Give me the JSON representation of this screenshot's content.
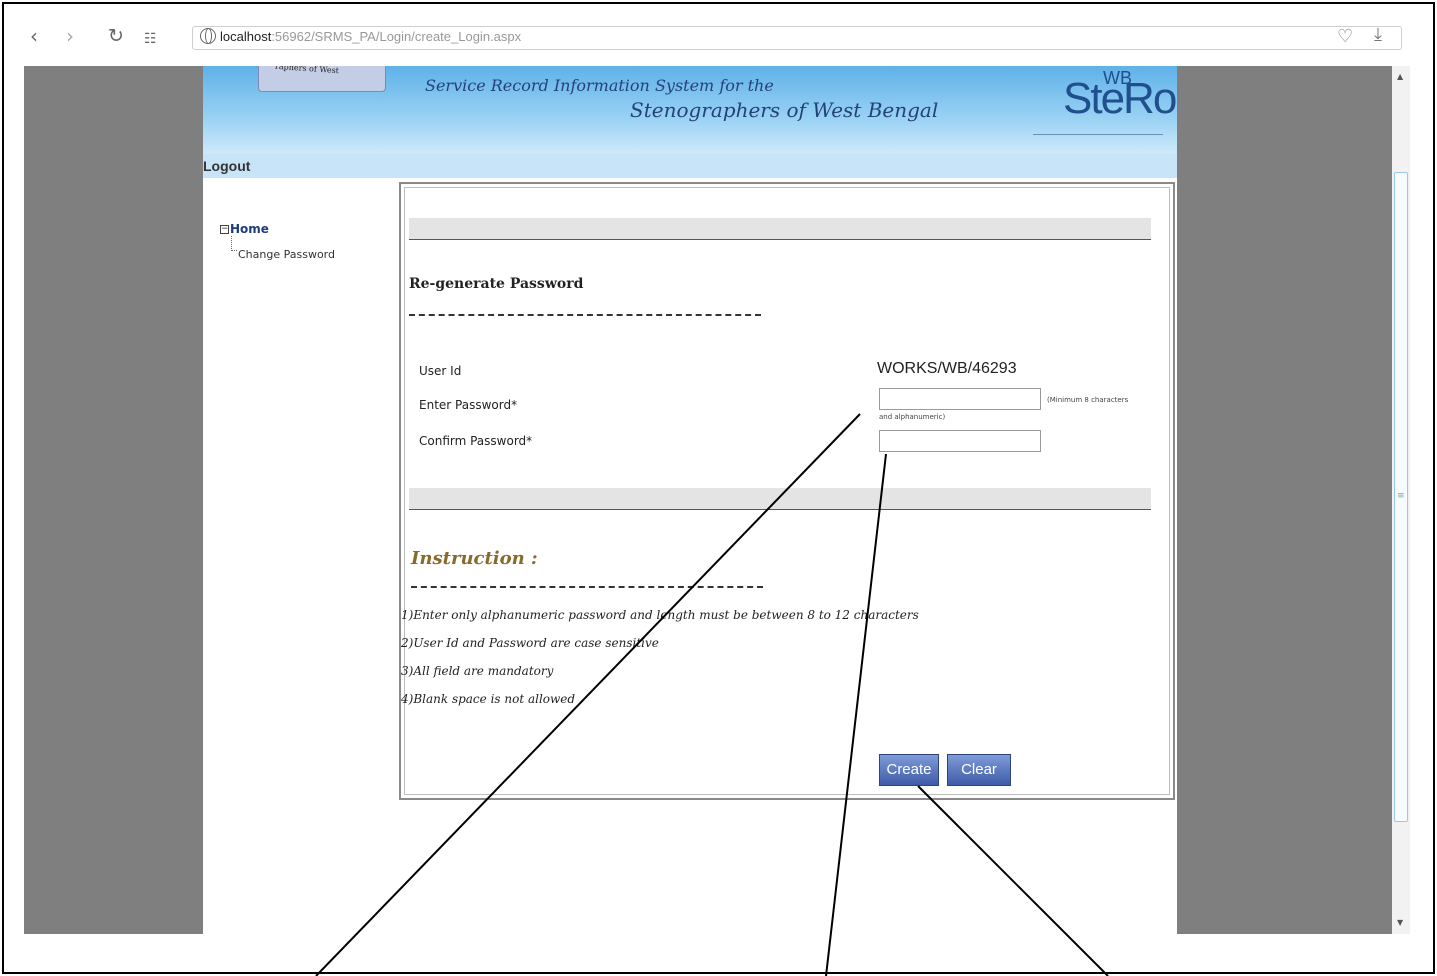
{
  "browser": {
    "back_icon": "chevron-left-icon",
    "forward_icon": "chevron-right-icon",
    "url_host": "localhost",
    "url_rest": ":56962/SRMS_PA/Login/create_Login.aspx"
  },
  "banner": {
    "logo_text": "raphers of West",
    "line1": "Service Record Information System for the",
    "line2": "Stenographers of West Bengal",
    "brand": "SteRo",
    "brand_small": "WB"
  },
  "nav": {
    "logout": "Logout",
    "tree_home": "Home",
    "tree_item": "Change Password"
  },
  "form": {
    "title": "Re-generate Password",
    "user_id_label": "User Id",
    "user_id_value": "WORKS/WB/46293",
    "enter_password_label": "Enter Password*",
    "password_hint_1": "(Minimum 8 characters",
    "password_hint_2": "and alphanumeric)",
    "confirm_password_label": "Confirm Password*",
    "create_button": "Create",
    "clear_button": "Clear"
  },
  "instructions": {
    "title": "Instruction :",
    "items": [
      "1)Enter only alphanumeric password and length must be between 8 to 12 characters",
      "2)User Id and Password are case sensitive",
      "3)All field are mandatory",
      "4)Blank space is not allowed"
    ]
  },
  "colors": {
    "banner": "#5fb1e8",
    "button": "#4a67b3",
    "instruction_title": "#8a6a2a"
  }
}
